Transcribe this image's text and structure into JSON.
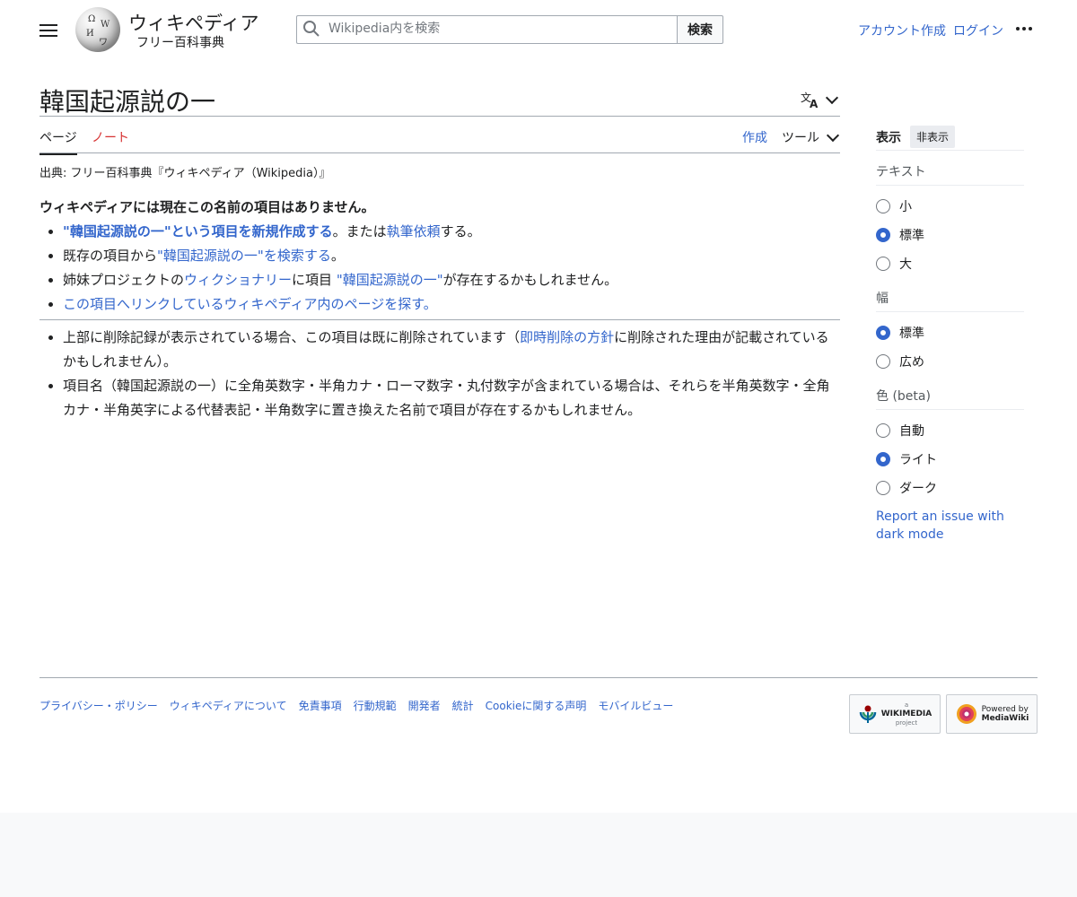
{
  "header": {
    "site_title": "ウィキペディア",
    "site_tagline": "フリー百科事典",
    "search_placeholder": "Wikipedia内を検索",
    "search_button": "検索",
    "create_account": "アカウント作成",
    "login": "ログイン"
  },
  "page": {
    "title": "韓国起源説の一",
    "tabs": {
      "page": "ページ",
      "talk": "ノート",
      "create": "作成",
      "tools": "ツール"
    },
    "from_line": "出典: フリー百科事典『ウィキペディア（Wikipedia）』",
    "notice": "ウィキペディアには現在この名前の項目はありません。",
    "list1": [
      {
        "link": "\"韓国起源説の一\"という項目を新規作成する",
        "text": "。または",
        "link2": "執筆依頼",
        "text2": "する。"
      },
      {
        "pre": "既存の項目から",
        "link": "\"韓国起源説の一\"を検索する",
        "post": "。"
      },
      {
        "pre": "姉妹プロジェクトの",
        "link": "ウィクショナリー",
        "mid": "に項目 ",
        "link2": "\"韓国起源説の一\"",
        "post": "が存在するかもしれません。"
      },
      {
        "link": "この項目へリンクしているウィキペディア内のページを探す",
        "post": "。"
      }
    ],
    "list2": [
      {
        "pre": "上部に削除記録が表示されている場合、この項目は既に削除されています（",
        "link": "即時削除の方針",
        "post": "に削除された理由が記載されているかもしれません）。"
      },
      {
        "text": "項目名（韓国起源説の一）に全角英数字・半角カナ・ローマ数字・丸付数字が含まれている場合は、それらを半角英数字・全角カナ・半角英字による代替表記・半角数字に置き換えた名前で項目が存在するかもしれません。"
      }
    ]
  },
  "sidebar": {
    "title": "表示",
    "hide": "非表示",
    "text_label": "テキスト",
    "text_options": [
      "小",
      "標準",
      "大"
    ],
    "text_selected": "標準",
    "width_label": "幅",
    "width_options": [
      "標準",
      "広め"
    ],
    "width_selected": "標準",
    "color_label": "色 (beta)",
    "color_options": [
      "自動",
      "ライト",
      "ダーク"
    ],
    "color_selected": "ライト",
    "report": "Report an issue with dark mode"
  },
  "footer": {
    "links": [
      "プライバシー・ポリシー",
      "ウィキペディアについて",
      "免責事項",
      "行動規範",
      "開発者",
      "統計",
      "Cookieに関する声明",
      "モバイルビュー"
    ],
    "wikimedia_badge": {
      "small": "a",
      "main": "WIKIMEDIA",
      "sub": "project"
    },
    "mediawiki_badge": {
      "line1": "Powered by",
      "line2": "MediaWiki"
    }
  },
  "colors": {
    "link": "#3366cc",
    "talk_red": "#d73333",
    "text": "#202122",
    "border": "#a2a9b1"
  }
}
